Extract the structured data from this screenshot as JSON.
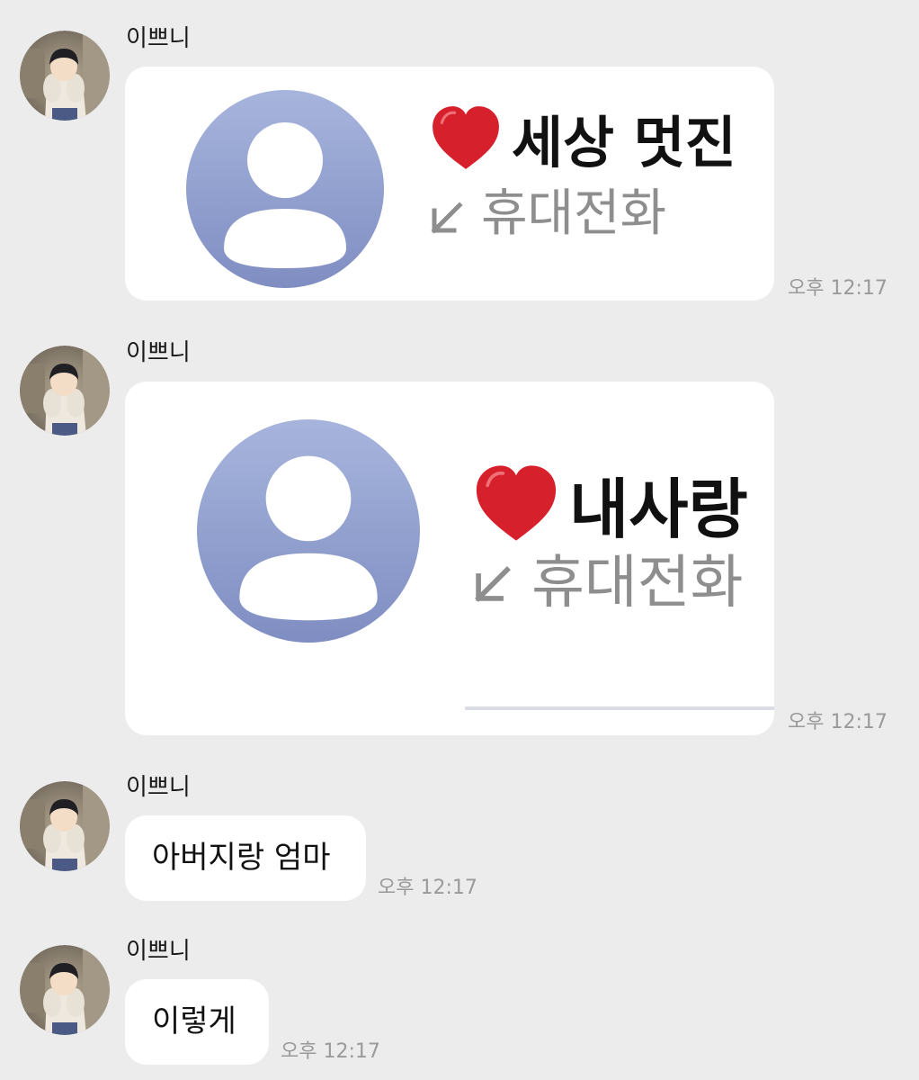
{
  "colors": {
    "background": "#ececec",
    "bubble": "#ffffff",
    "profile_top": "#a7b5dd",
    "profile_bottom": "#7f8dc2",
    "heart": "#d6202b",
    "timestamp": "#9a9a9a"
  },
  "messages": [
    {
      "sender": "이쁘니",
      "type": "contact-image",
      "contact_name": "세상 멋진",
      "contact_label": "휴대전화",
      "icons": [
        "avatar-photo",
        "default-profile-icon",
        "red-heart-icon",
        "incoming-call-arrow-icon"
      ],
      "time": "오후 12:17"
    },
    {
      "sender": "이쁘니",
      "type": "contact-image",
      "contact_name": "내사랑",
      "contact_label": "휴대전화",
      "icons": [
        "avatar-photo",
        "default-profile-icon",
        "red-heart-icon",
        "incoming-call-arrow-icon"
      ],
      "time": "오후 12:17"
    },
    {
      "sender": "이쁘니",
      "type": "text",
      "text": "아버지랑 엄마",
      "time": "오후 12:17"
    },
    {
      "sender": "이쁘니",
      "type": "text",
      "text": "이렇게",
      "time": "오후 12:17"
    }
  ]
}
